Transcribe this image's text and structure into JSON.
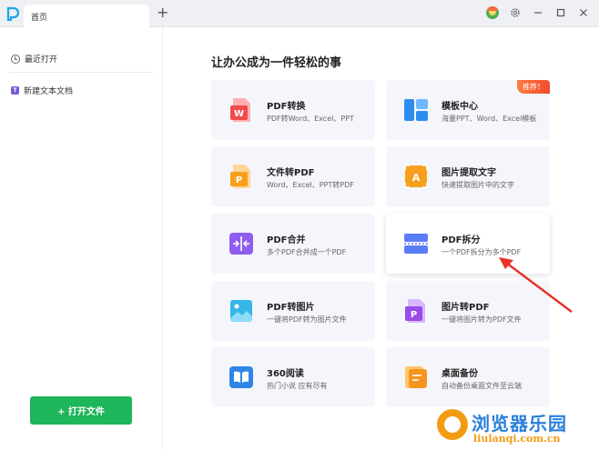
{
  "titlebar": {
    "tab_label": "首页",
    "add_tab_symbol": "+",
    "icons": [
      "avatar-icon",
      "gear-icon",
      "minimize-icon",
      "maximize-icon",
      "close-icon"
    ]
  },
  "sidebar": {
    "recent_label": "最近打开",
    "new_doc_label": "新建文本文档",
    "open_button_label": "+ 打开文件"
  },
  "main": {
    "heading": "让办公成为一件轻松的事",
    "cards": [
      {
        "title": "PDF转换",
        "desc": "PDF转Word、Excel、PPT",
        "icon": "pdf-convert-icon"
      },
      {
        "title": "模板中心",
        "desc": "海量PPT、Word、Excel模板",
        "icon": "template-icon",
        "badge": "推荐！"
      },
      {
        "title": "文件转PDF",
        "desc": "Word、Excel、PPT转PDF",
        "icon": "file-to-pdf-icon"
      },
      {
        "title": "图片提取文字",
        "desc": "快速提取图片中的文字",
        "icon": "ocr-icon"
      },
      {
        "title": "PDF合并",
        "desc": "多个PDF合并成一个PDF",
        "icon": "pdf-merge-icon"
      },
      {
        "title": "PDF拆分",
        "desc": "一个PDF拆分为多个PDF",
        "icon": "pdf-split-icon"
      },
      {
        "title": "PDF转图片",
        "desc": "一键将PDF转为图片文件",
        "icon": "pdf-to-image-icon"
      },
      {
        "title": "图片转PDF",
        "desc": "一键将图片转为PDF文件",
        "icon": "image-to-pdf-icon"
      },
      {
        "title": "360阅读",
        "desc": "热门小说 应有尽有",
        "icon": "reading-icon"
      },
      {
        "title": "桌面备份",
        "desc": "自动备份桌面文件至云端",
        "icon": "desktop-backup-icon"
      }
    ]
  },
  "watermark": {
    "title": "浏览器乐园",
    "url": "liulanqi.com.cn"
  },
  "colors": {
    "accent_green": "#1fb55a",
    "badge_red": "#f24b2e",
    "arrow_red": "#e8322a"
  }
}
